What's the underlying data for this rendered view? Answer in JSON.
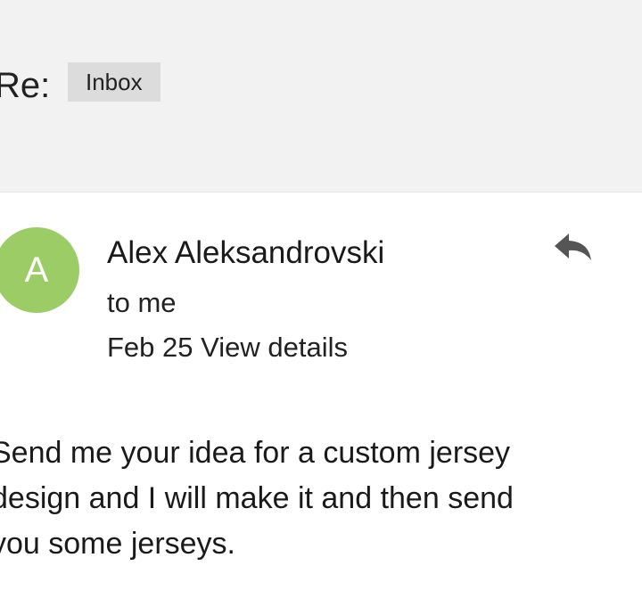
{
  "message": {
    "subject": "Re:",
    "label": "Inbox",
    "avatar_letter": "A",
    "avatar_color": "#9ccc65",
    "sender": "Alex Aleksandrovski",
    "recipient": "to me",
    "date": "Feb 25",
    "details_link": "View details",
    "reply_icon": "reply-icon",
    "body_lines": [
      "Send me your idea for a custom jersey",
      "design and I will make it and then send",
      "you some jerseys."
    ]
  }
}
